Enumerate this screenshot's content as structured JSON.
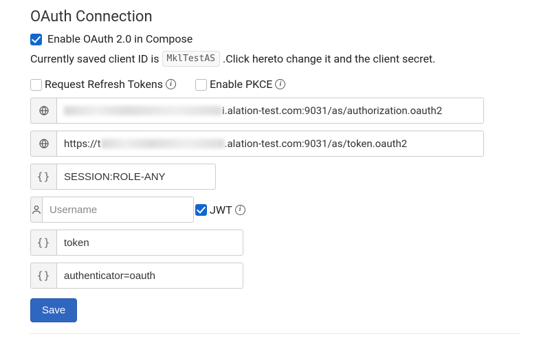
{
  "section_title": "OAuth Connection",
  "enable_oauth": {
    "checked": true,
    "label": "Enable OAuth 2.0 in Compose"
  },
  "client_id_line": {
    "prefix": "Currently saved client ID is",
    "client_id": "MklTestAS",
    "suffix_a": ".Click here",
    "suffix_b": "to change it and the client secret."
  },
  "options": {
    "refresh_tokens": {
      "checked": false,
      "label": "Request Refresh Tokens"
    },
    "pkce": {
      "checked": false,
      "label": "Enable PKCE"
    }
  },
  "fields": {
    "authorize_url_tail": "i.alation-test.com:9031/as/authorization.oauth2",
    "token_url_prefix": "https://t",
    "token_url_tail": ".alation-test.com:9031/as/token.oauth2",
    "scope": "SESSION:ROLE-ANY",
    "username_placeholder": "Username",
    "jwt": {
      "checked": true,
      "label": "JWT"
    },
    "token": "token",
    "extra": "authenticator=oauth"
  },
  "save_label": "Save"
}
